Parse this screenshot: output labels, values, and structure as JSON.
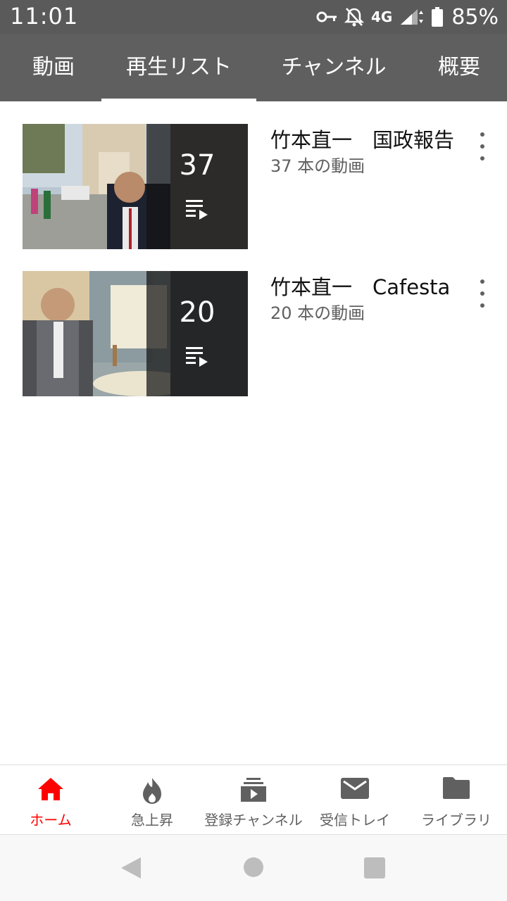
{
  "status_bar": {
    "time": "11:01",
    "network": "4G",
    "battery": "85%",
    "icons": [
      "vpn-key-icon",
      "notifications-off-icon",
      "cellular-signal-icon",
      "battery-icon"
    ]
  },
  "tabs": [
    {
      "label": "動画",
      "selected": false
    },
    {
      "label": "再生リスト",
      "selected": true
    },
    {
      "label": "チャンネル",
      "selected": false
    },
    {
      "label": "概要",
      "selected": false
    }
  ],
  "playlists": [
    {
      "title": "竹本直一　国政報告",
      "subtitle": "37 本の動画",
      "count": "37"
    },
    {
      "title": "竹本直一　Cafesta",
      "subtitle": "20 本の動画",
      "count": "20"
    }
  ],
  "bottom_nav": [
    {
      "label": "ホーム",
      "icon": "home-icon",
      "active": true
    },
    {
      "label": "急上昇",
      "icon": "trending-flame-icon",
      "active": false
    },
    {
      "label": "登録チャンネル",
      "icon": "subscriptions-icon",
      "active": false
    },
    {
      "label": "受信トレイ",
      "icon": "inbox-mail-icon",
      "active": false
    },
    {
      "label": "ライブラリ",
      "icon": "library-folder-icon",
      "active": false
    }
  ],
  "colors": {
    "accent": "#ff0000",
    "tab_bar": "#5f5f5f",
    "status_bar": "#5a5a5a"
  }
}
